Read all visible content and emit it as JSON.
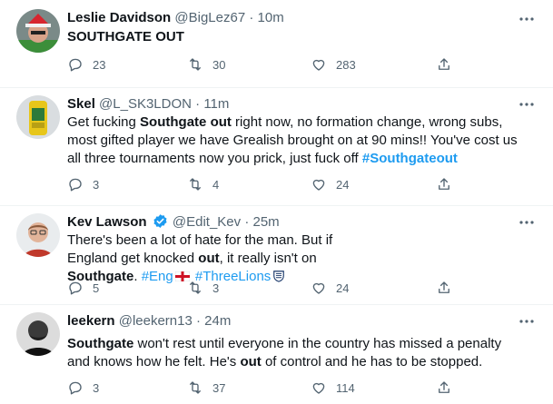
{
  "tweets": [
    {
      "name": "Leslie Davidson",
      "handle": "@BigLez67",
      "dot": "·",
      "time": "10m",
      "text": {
        "t1": "SOUTHGATE OUT"
      },
      "replies": "23",
      "retweets": "30",
      "likes": "283"
    },
    {
      "name": "Skel",
      "handle": "@L_SK3LDON",
      "dot": "·",
      "time": "11m",
      "text": {
        "t1": "Get fucking ",
        "hl1": "Southgate",
        "t2": " ",
        "hl2": "out",
        "t3": " right now, no formation change, wrong subs, most gifted player we have Grealish brought on at 90 mins!! You've cost us all three tournaments now you prick, just fuck off ",
        "tag1": "#Southgateout"
      },
      "replies": "3",
      "retweets": "4",
      "likes": "24"
    },
    {
      "name": "Kev Lawson",
      "handle": "@Edit_Kev",
      "dot": "·",
      "time": "25m",
      "text": {
        "t1": "There's been a lot of hate for the man. But if England get knocked ",
        "hl1": "out",
        "t2": ", it really isn't on ",
        "hl2": "Southgate",
        "t3": ". ",
        "tag1": "#Eng",
        "tag2": "#ThreeLions"
      },
      "replies": "5",
      "retweets": "3",
      "likes": "24"
    },
    {
      "name": "leekern",
      "handle": "@leekern13",
      "dot": "·",
      "time": "24m",
      "text": {
        "hl1": "Southgate",
        "t1": " won't rest until everyone in the country has missed a penalty and knows how he felt. He's ",
        "hl2": "out",
        "t2": " of control and he has to be stopped."
      },
      "replies": "3",
      "retweets": "37",
      "likes": "114"
    }
  ],
  "colors": {
    "link": "#1d9bf0",
    "verified": "#1d9bf0",
    "secondary": "#536471"
  }
}
